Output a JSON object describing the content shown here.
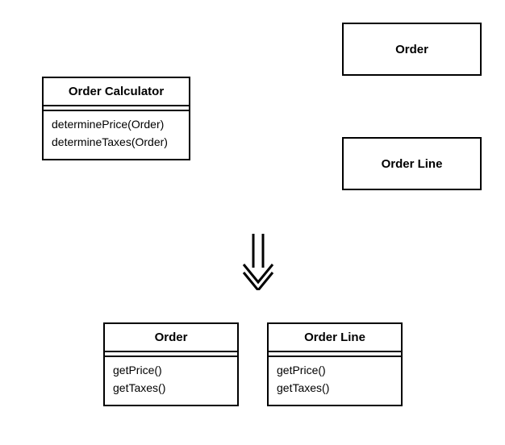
{
  "top": {
    "calculator": {
      "title": "Order Calculator",
      "methods": [
        "determinePrice(Order)",
        "determineTaxes(Order)"
      ]
    },
    "order": {
      "title": "Order"
    },
    "order_line": {
      "title": "Order Line"
    }
  },
  "bottom": {
    "order": {
      "title": "Order",
      "methods": [
        "getPrice()",
        "getTaxes()"
      ]
    },
    "order_line": {
      "title": "Order Line",
      "methods": [
        "getPrice()",
        "getTaxes()"
      ]
    }
  }
}
